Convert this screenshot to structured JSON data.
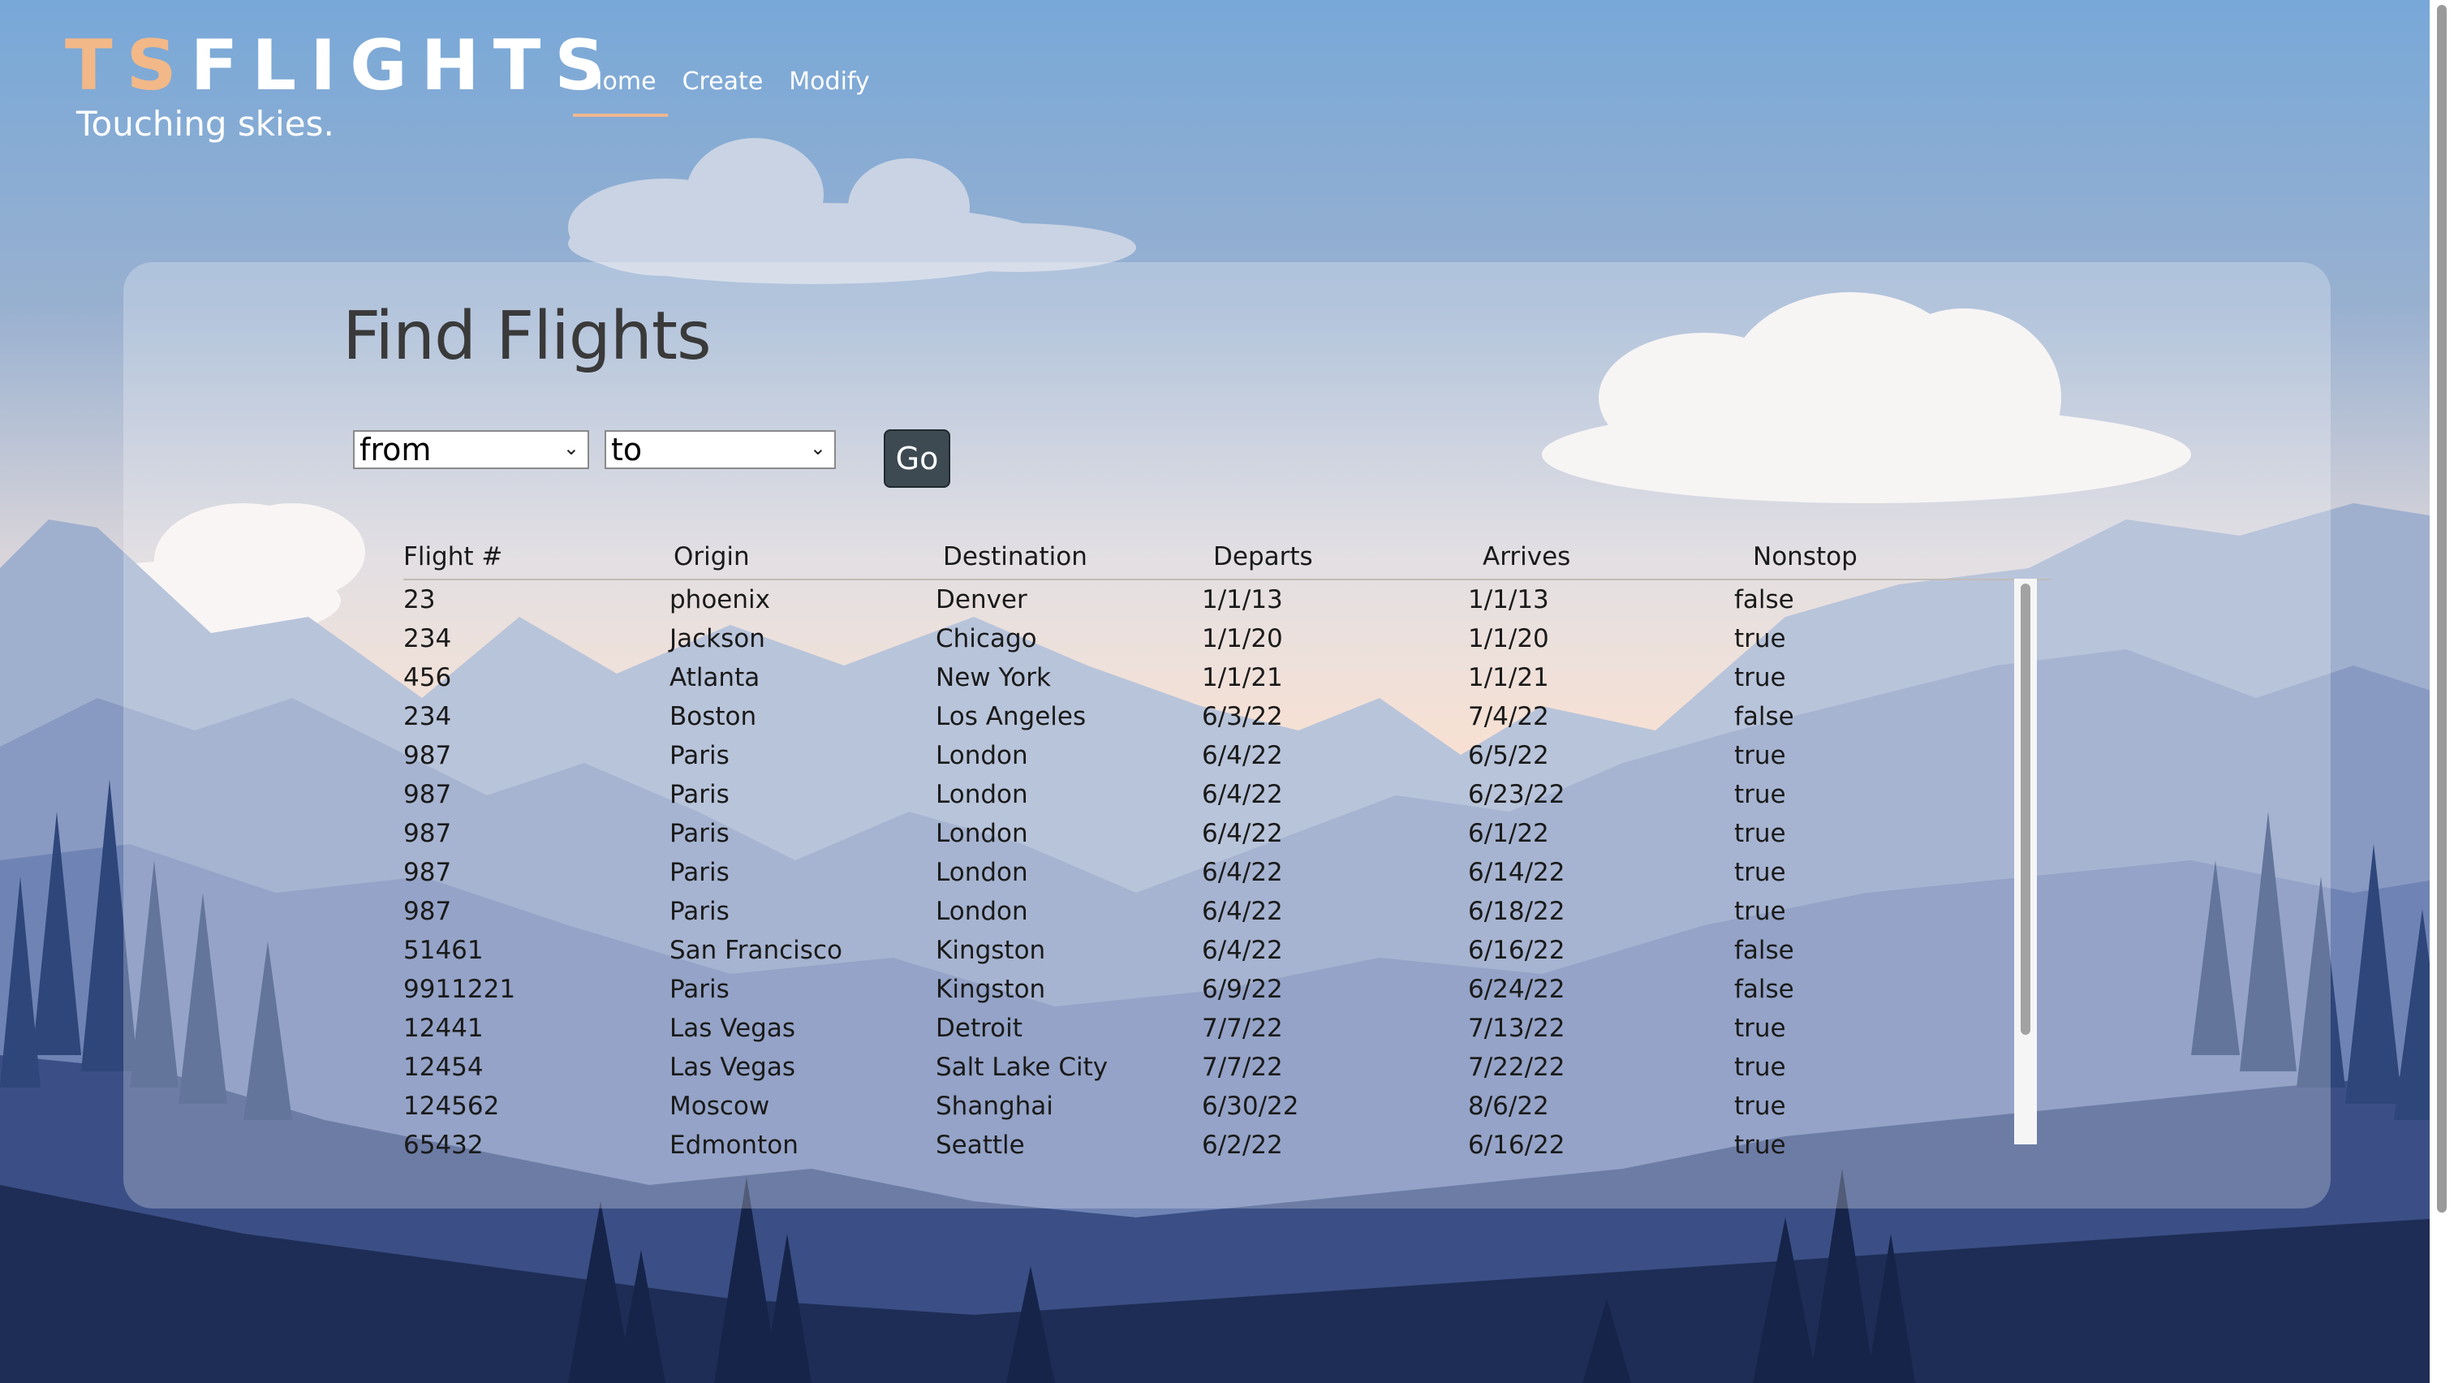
{
  "brand": {
    "logo_ts": "TS",
    "logo_flights": "FLIGHTS",
    "tagline": "Touching skies."
  },
  "nav": {
    "items": [
      {
        "label": "Home",
        "active": true
      },
      {
        "label": "Create",
        "active": false
      },
      {
        "label": "Modify",
        "active": false
      }
    ]
  },
  "search": {
    "title": "Find Flights",
    "from_select": "from",
    "to_select": "to",
    "go_label": "Go"
  },
  "table": {
    "columns": [
      "Flight #",
      "Origin",
      "Destination",
      "Departs",
      "Arrives",
      "Nonstop"
    ],
    "rows": [
      [
        "23",
        "phoenix",
        "Denver",
        "1/1/13",
        "1/1/13",
        "false"
      ],
      [
        "234",
        "Jackson",
        "Chicago",
        "1/1/20",
        "1/1/20",
        "true"
      ],
      [
        "456",
        "Atlanta",
        "New York",
        "1/1/21",
        "1/1/21",
        "true"
      ],
      [
        "234",
        "Boston",
        "Los Angeles",
        "6/3/22",
        "7/4/22",
        "false"
      ],
      [
        "987",
        "Paris",
        "London",
        "6/4/22",
        "6/5/22",
        "true"
      ],
      [
        "987",
        "Paris",
        "London",
        "6/4/22",
        "6/23/22",
        "true"
      ],
      [
        "987",
        "Paris",
        "London",
        "6/4/22",
        "6/1/22",
        "true"
      ],
      [
        "987",
        "Paris",
        "London",
        "6/4/22",
        "6/14/22",
        "true"
      ],
      [
        "987",
        "Paris",
        "London",
        "6/4/22",
        "6/18/22",
        "true"
      ],
      [
        "51461",
        "San Francisco",
        "Kingston",
        "6/4/22",
        "6/16/22",
        "false"
      ],
      [
        "9911221",
        "Paris",
        "Kingston",
        "6/9/22",
        "6/24/22",
        "false"
      ],
      [
        "12441",
        "Las Vegas",
        "Detroit",
        "7/7/22",
        "7/13/22",
        "true"
      ],
      [
        "12454",
        "Las Vegas",
        "Salt Lake City",
        "7/7/22",
        "7/22/22",
        "true"
      ],
      [
        "124562",
        "Moscow",
        "Shanghai",
        "6/30/22",
        "8/6/22",
        "true"
      ],
      [
        "65432",
        "Edmonton",
        "Seattle",
        "6/2/22",
        "6/16/22",
        "true"
      ]
    ]
  },
  "colors": {
    "sky_top": "#7aa7d6",
    "sky_horizon": "#f7d4bf",
    "accent_orange": "#f2b887",
    "go_button": "#3d4a52",
    "mountain_far": "#8da3c9",
    "mountain_dark": "#1a2a4e"
  },
  "icons": {
    "select_chevron": "chevron-down-icon"
  }
}
